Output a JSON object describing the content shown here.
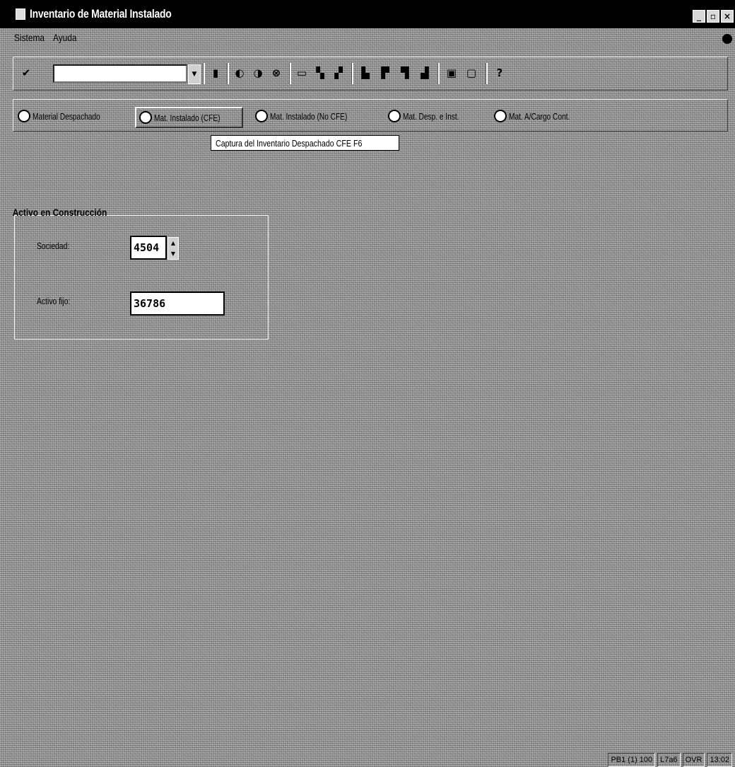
{
  "window": {
    "title": "Inventario de Material Instalado"
  },
  "menu": [
    "Sistema",
    "Ayuda"
  ],
  "tabs": [
    {
      "label": "Material Despachado"
    },
    {
      "label": "Mat. Instalado (CFE)"
    },
    {
      "label": "Mat. Instalado (No CFE)"
    },
    {
      "label": "Mat. Desp. e Inst."
    },
    {
      "label": "Mat. A/Cargo Cont."
    }
  ],
  "tooltip": "Captura del Inventario Despachado CFE   F6",
  "form": {
    "group_title": "Activo en Construcción",
    "sociedad": {
      "label": "Sociedad:",
      "value": "4504"
    },
    "activo_fijo": {
      "label": "Activo fijo:",
      "value": "36786"
    }
  },
  "status": [
    "PB1 (1) 100",
    "L7a6",
    "OVR",
    "13:02"
  ]
}
